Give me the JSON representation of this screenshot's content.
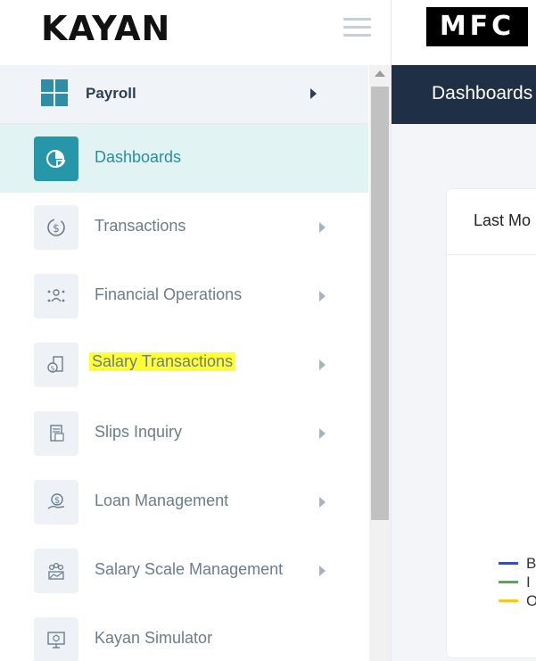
{
  "logo": {
    "text": "KAYAN"
  },
  "brand": {
    "text": "MFC"
  },
  "sidebar": {
    "module": {
      "label": "Payroll"
    },
    "items": [
      {
        "label": "Dashboards",
        "icon": "dashboard-icon"
      },
      {
        "label": "Transactions",
        "icon": "dollar-refresh-icon"
      },
      {
        "label": "Financial Operations",
        "icon": "people-network-icon"
      },
      {
        "label": "Salary Transactions",
        "icon": "salary-document-icon"
      },
      {
        "label": "Slips Inquiry",
        "icon": "slip-document-icon"
      },
      {
        "label": "Loan Management",
        "icon": "loan-hand-icon"
      },
      {
        "label": "Salary Scale Management",
        "icon": "team-chart-icon"
      },
      {
        "label": "Kayan Simulator",
        "icon": "monitor-icon"
      }
    ]
  },
  "topbar": {
    "title": "Dashboards"
  },
  "card": {
    "title": "Last Mo"
  },
  "legend": [
    {
      "label": "B",
      "color": "#3a4fb5"
    },
    {
      "label": "I",
      "color": "#4caf50"
    },
    {
      "label": "O",
      "color": "#f7c71c"
    }
  ],
  "colors": {
    "accent": "#2597a8",
    "topbar": "#1e2f46",
    "highlight": "#ffff33"
  }
}
